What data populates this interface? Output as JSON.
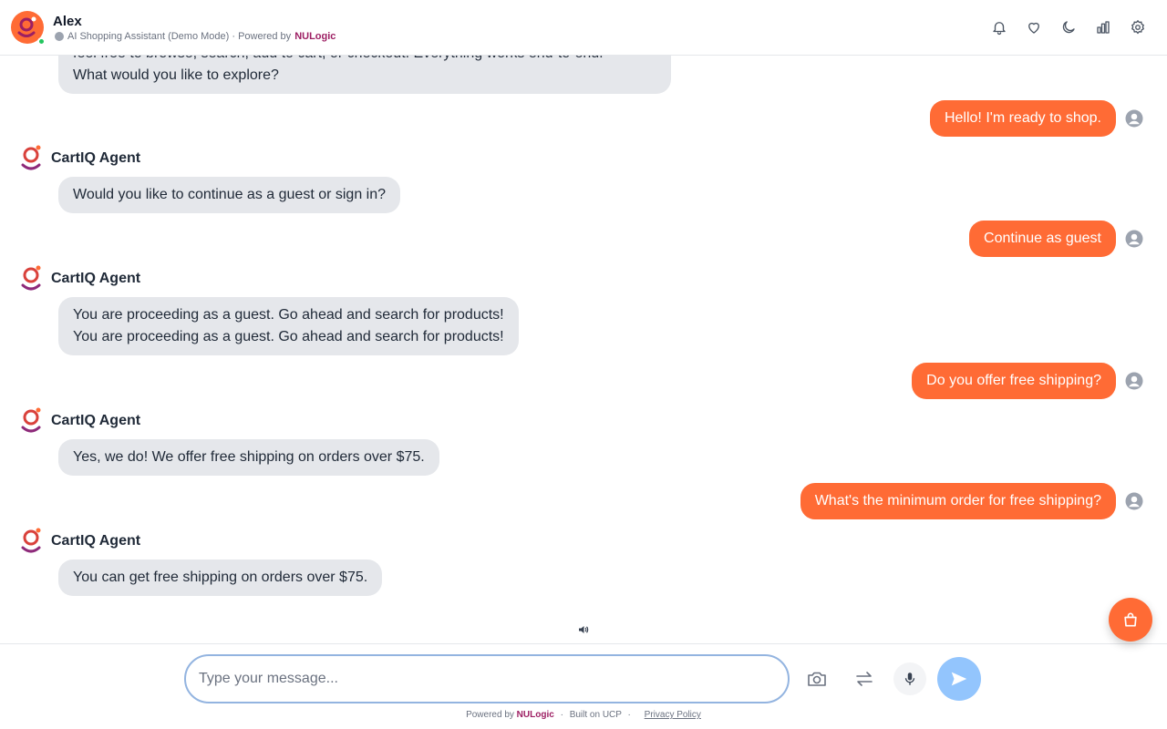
{
  "header": {
    "name": "Alex",
    "subtitle": "AI Shopping Assistant (Demo Mode) · Powered by",
    "brand": "NULogic",
    "icons": [
      "bell-icon",
      "heart-icon",
      "moon-icon",
      "bar-chart-icon",
      "gear-icon"
    ]
  },
  "chat": {
    "agent_name": "CartIQ Agent",
    "intro_partial_line1": "feel free to browse, search, add to cart, or checkout. Everything works end-to-end.",
    "intro_partial_line2": "What would you like to explore?",
    "messages": [
      {
        "role": "user",
        "text": "Hello! I'm ready to shop."
      },
      {
        "role": "agent",
        "text": "Would you like to continue as a guest or sign in?"
      },
      {
        "role": "user",
        "text": "Continue as guest"
      },
      {
        "role": "agent",
        "line1": "You are proceeding as a guest. Go ahead and search for products!",
        "line2": "You are proceeding as a guest. Go ahead and search for products!"
      },
      {
        "role": "user",
        "text": "Do you offer free shipping?"
      },
      {
        "role": "agent",
        "text": "Yes, we do! We offer free shipping on orders over $75."
      },
      {
        "role": "user",
        "text": "What's the minimum order for free shipping?"
      },
      {
        "role": "agent",
        "text": "You can get free shipping on orders over $75."
      }
    ]
  },
  "composer": {
    "placeholder": "Type your message...",
    "value": ""
  },
  "footer": {
    "powered_by": "Powered by",
    "brand": "NULogic",
    "built_on": "Built on UCP",
    "privacy": "Privacy Policy"
  },
  "colors": {
    "accent": "#ff6b35",
    "brand": "#9d1f63",
    "bot_bubble": "#e5e7eb",
    "send_button": "#93c5fd"
  }
}
